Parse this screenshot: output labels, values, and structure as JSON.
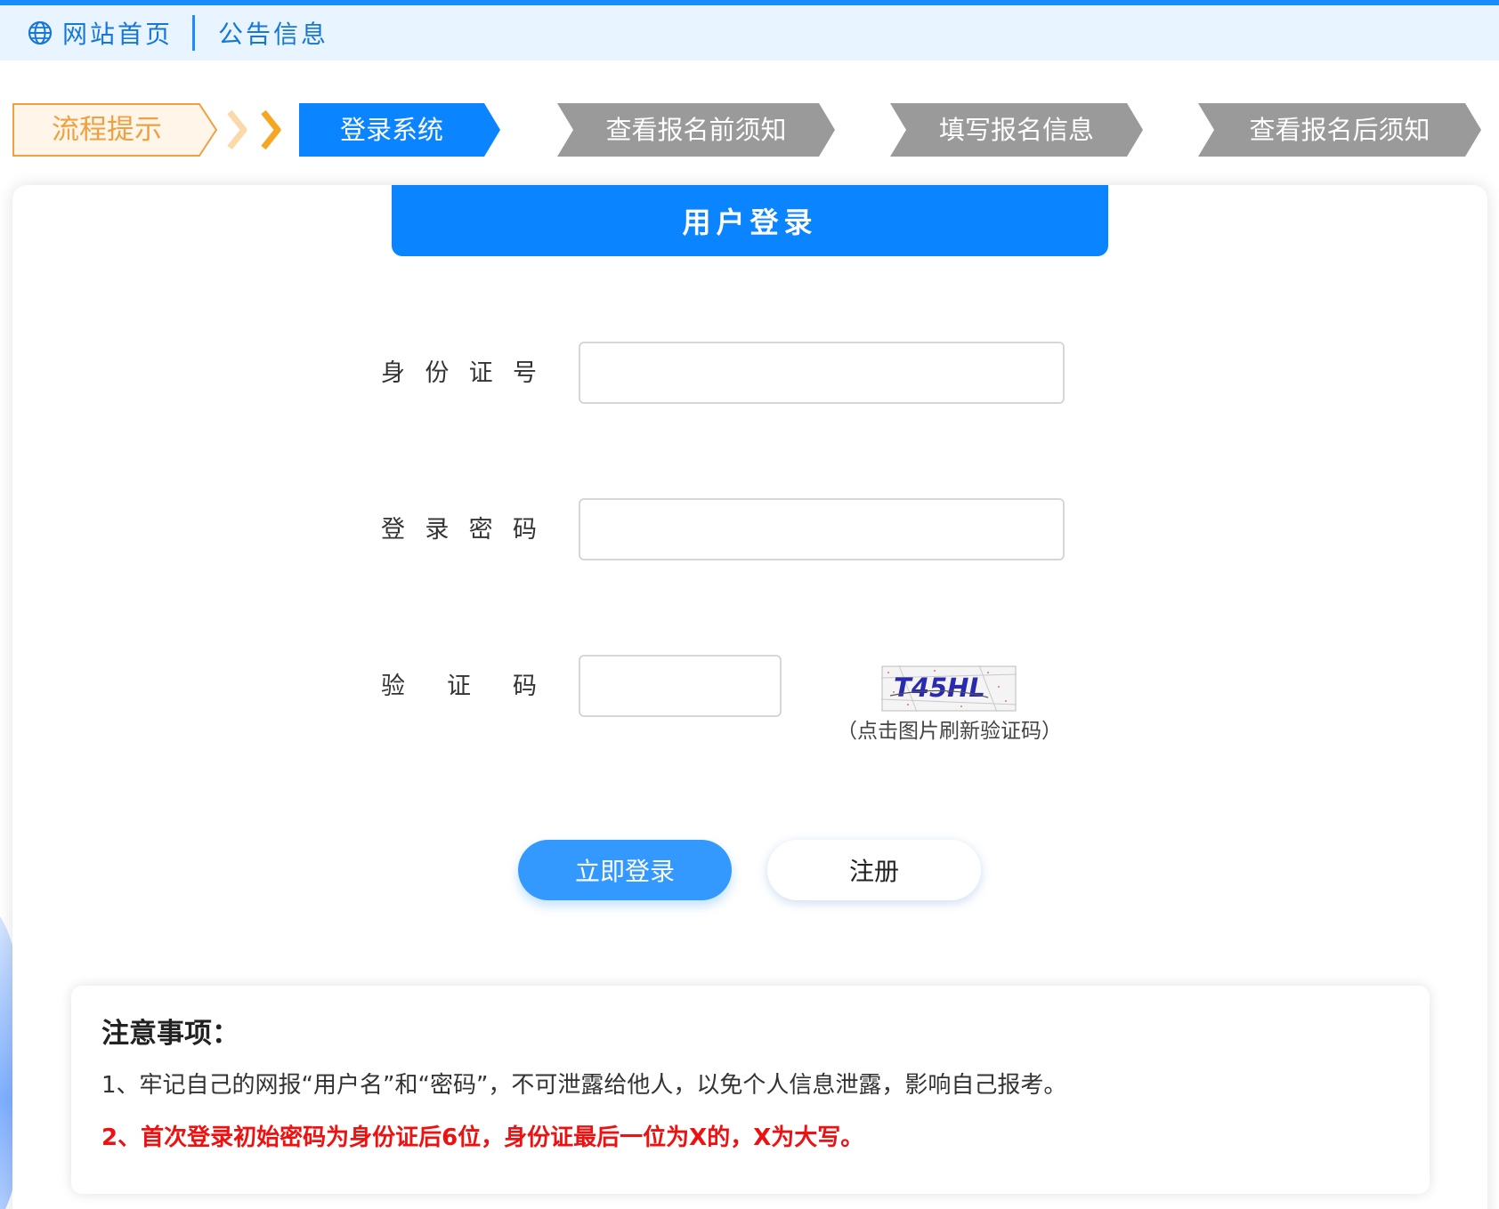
{
  "topbar": {
    "home_label": "网站首页",
    "notice_label": "公告信息"
  },
  "steps": {
    "hint": "流程提示",
    "items": [
      {
        "label": "登录系统",
        "state": "active",
        "color": "#0a84ff"
      },
      {
        "label": "查看报名前须知",
        "state": "inactive",
        "color": "#9a9a9a"
      },
      {
        "label": "填写报名信息",
        "state": "inactive",
        "color": "#9a9a9a"
      },
      {
        "label": "查看报名后须知",
        "state": "inactive",
        "color": "#9a9a9a"
      }
    ]
  },
  "login": {
    "title": "用户登录",
    "id_label": "身份证号",
    "id_value": "",
    "password_label": "登录密码",
    "password_value": "",
    "captcha_label": "验证码",
    "captcha_value": "",
    "captcha_image_text": "T45HL",
    "captcha_tip": "（点击图片刷新验证码）",
    "login_button": "立即登录",
    "register_button": "注册"
  },
  "notice": {
    "title": "注意事项：",
    "items": [
      "1、牢记自己的网报“用户名”和“密码”，不可泄露给他人，以免个人信息泄露，影响自己报考。",
      "2、首次登录初始密码为身份证后6位，身份证最后一位为X的，X为大写。"
    ]
  },
  "colors": {
    "primary": "#0a84ff",
    "hint_orange": "#f0a040",
    "warning_red": "#ee1111"
  }
}
